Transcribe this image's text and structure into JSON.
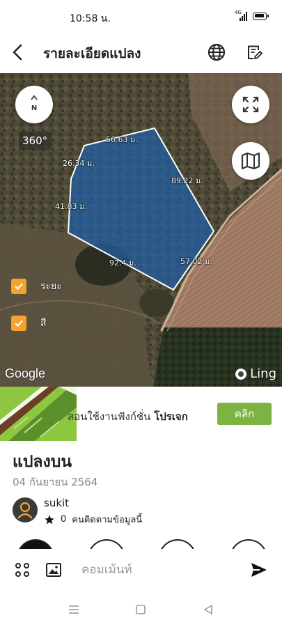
{
  "status_bar": {
    "time": "10:58 น.",
    "network": "4G"
  },
  "header": {
    "title": "รายละเอียดแปลง",
    "back_icon": "arrow-back-icon",
    "language_icon": "globe-icon",
    "edit_icon": "edit-note-icon"
  },
  "map": {
    "compass_label": "N",
    "view_360_label": "360°",
    "measurements": [
      "56.63 ม.",
      "26.34 ม.",
      "89.22 ม.",
      "41.83 ม.",
      "92.4 ม.",
      "57.02 ม."
    ],
    "layers": [
      {
        "label": "ระยะ",
        "checked": true
      },
      {
        "label": "สี",
        "checked": true
      }
    ],
    "google_label": "Google",
    "ling_label": "Ling",
    "polygon_fill": "#1f5fa8"
  },
  "promo": {
    "text": "สอนใช้งานฟังก์ชั่น",
    "text_bold": "โปรเจก",
    "button_label": "คลิก",
    "button_color": "#7cb342"
  },
  "plot": {
    "title": "แปลงบน",
    "date": "04 กันยายน 2564"
  },
  "owner": {
    "name": "sukit",
    "followers_count": "0",
    "followers_text": "คนติดตามข้อมูลนี้"
  },
  "comment": {
    "placeholder": "คอมเม้นท์"
  },
  "accent_color": "#f4a330"
}
